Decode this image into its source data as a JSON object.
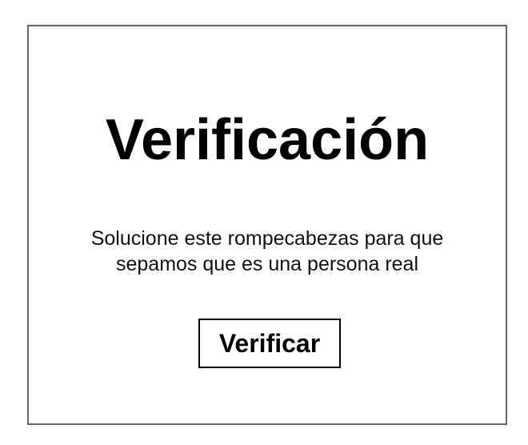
{
  "verification": {
    "title": "Verificación",
    "description": "Solucione este rompecabezas para que sepamos que es una persona real",
    "button_label": "Verificar"
  },
  "colors": {
    "border": "#666666",
    "text": "#000000",
    "background": "#ffffff"
  }
}
